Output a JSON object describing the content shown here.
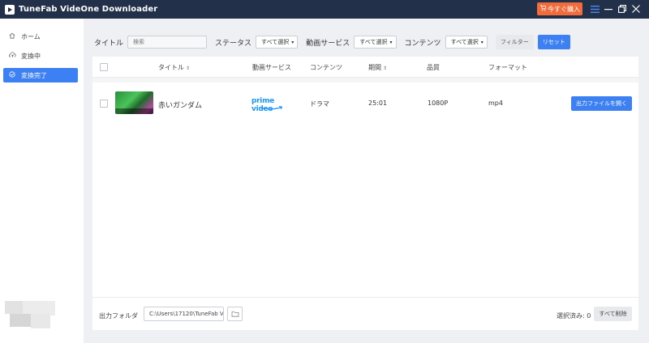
{
  "app": {
    "title": "TuneFab VideOne Downloader",
    "buy_label": "今すぐ購入"
  },
  "colors": {
    "titlebar": "#23304a",
    "accent": "#3d80f3",
    "buy": "#f26c3b",
    "prime": "#1a98ff"
  },
  "sidebar": {
    "items": [
      {
        "label": "ホーム",
        "icon": "home-icon"
      },
      {
        "label": "変換中",
        "icon": "cloud-upload-icon"
      },
      {
        "label": "変換完了",
        "icon": "check-circle-icon",
        "active": true
      }
    ]
  },
  "filters": {
    "title_label": "タイトル",
    "search_placeholder": "検索",
    "status_label": "ステータス",
    "status_value": "すべて選択",
    "service_label": "動画サービス",
    "service_value": "すべて選択",
    "content_label": "コンテンツ",
    "content_value": "すべて選択",
    "filter_button": "フィルター",
    "reset_button": "リセット"
  },
  "table": {
    "headers": {
      "title": "タイトル",
      "service": "動画サービス",
      "content": "コンテンツ",
      "duration": "期間",
      "quality": "品質",
      "format": "フォーマット"
    },
    "rows": [
      {
        "title": "赤いガンダム",
        "service_logo_text": "prime video",
        "content": "ドラマ",
        "duration": "25:01",
        "quality": "1080P",
        "format": "mp4",
        "action": "出力ファイルを開く"
      }
    ]
  },
  "footer": {
    "output_label": "出力フォルダ",
    "path_value": "C:\\Users\\17120\\TuneFab V",
    "selected_text": "選択済み: 0",
    "delete_all": "すべて削除"
  }
}
